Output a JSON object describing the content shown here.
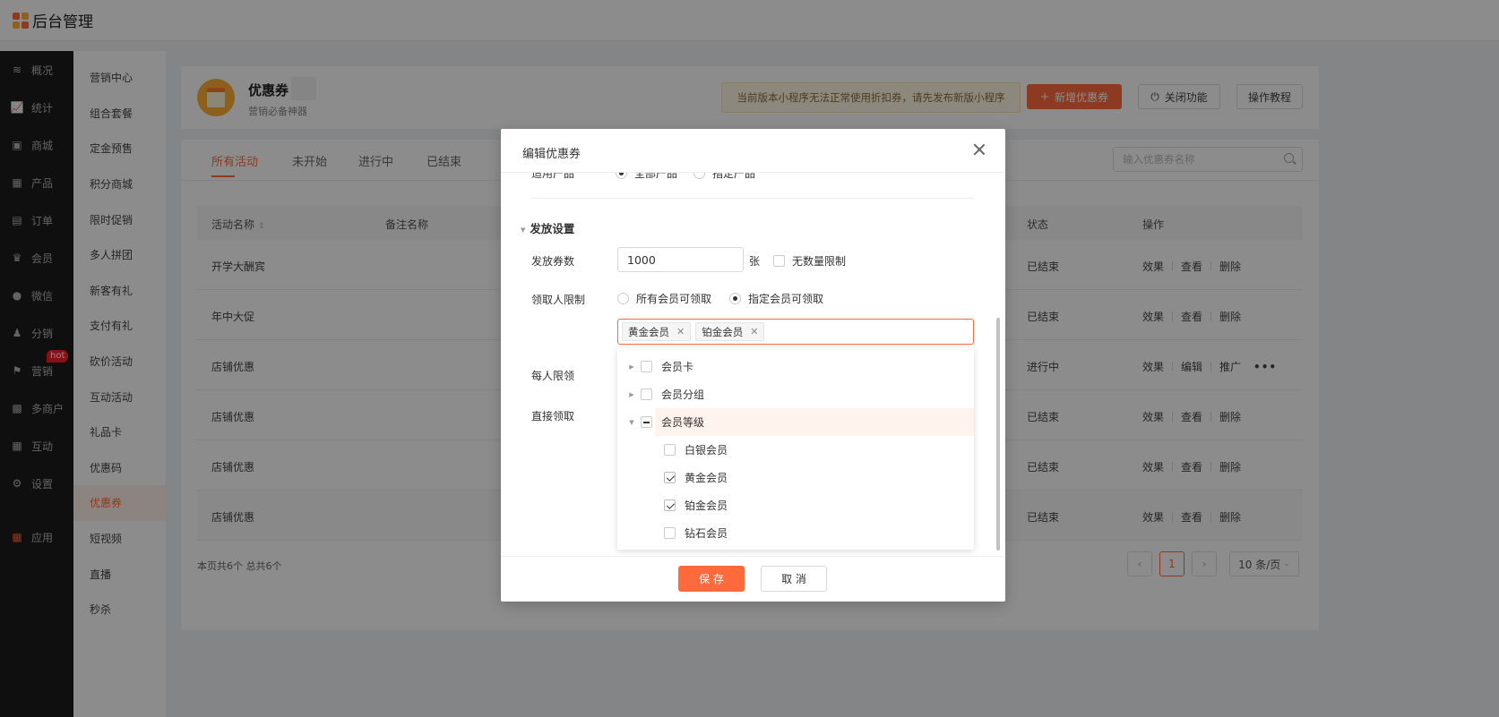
{
  "app": {
    "title": "后台管理"
  },
  "main_nav": [
    {
      "label": "概况",
      "icon": "overview-icon"
    },
    {
      "label": "统计",
      "icon": "chart-icon"
    },
    {
      "label": "商城",
      "icon": "shop-icon"
    },
    {
      "label": "产品",
      "icon": "grid-icon"
    },
    {
      "label": "订单",
      "icon": "order-icon"
    },
    {
      "label": "会员",
      "icon": "crown-icon"
    },
    {
      "label": "微信",
      "icon": "wechat-icon"
    },
    {
      "label": "分销",
      "icon": "users-icon"
    },
    {
      "label": "营销",
      "icon": "flag-icon",
      "badge": "hot",
      "active": true
    },
    {
      "label": "多商户",
      "icon": "store-icon"
    },
    {
      "label": "互动",
      "icon": "grid-icon"
    },
    {
      "label": "设置",
      "icon": "gear-icon"
    },
    {
      "label": "应用",
      "icon": "apps-icon"
    }
  ],
  "sub_nav": [
    "营销中心",
    "组合套餐",
    "定金预售",
    "积分商城",
    "限时促销",
    "多人拼团",
    "新客有礼",
    "支付有礼",
    "砍价活动",
    "互动活动",
    "礼品卡",
    "优惠码",
    "优惠券",
    "短视频",
    "直播",
    "秒杀"
  ],
  "sub_nav_active": "优惠券",
  "header": {
    "title": "优惠券",
    "subtitle": "营销必备神器",
    "notice": "当前版本小程序无法正常使用折扣券，请先发布新版小程序",
    "add_button": "新增优惠券",
    "close_button": "关闭功能",
    "tutorial_button": "操作教程"
  },
  "tabs": [
    "所有活动",
    "未开始",
    "进行中",
    "已结束"
  ],
  "search": {
    "placeholder": "输入优惠券名称"
  },
  "table": {
    "columns": {
      "name": "活动名称",
      "remark": "备注名称",
      "status": "状态",
      "ops": "操作"
    },
    "rows": [
      {
        "name": "开学大酬宾",
        "status": "已结束",
        "ops": [
          "效果",
          "查看",
          "删除"
        ]
      },
      {
        "name": "年中大促",
        "status": "已结束",
        "ops": [
          "效果",
          "查看",
          "删除"
        ]
      },
      {
        "name": "店铺优惠",
        "status": "进行中",
        "ops": [
          "效果",
          "编辑",
          "推广"
        ],
        "more": "•••"
      },
      {
        "name": "店铺优惠",
        "status": "已结束",
        "ops": [
          "效果",
          "查看",
          "删除"
        ]
      },
      {
        "name": "店铺优惠",
        "status": "已结束",
        "ops": [
          "效果",
          "查看",
          "删除"
        ]
      },
      {
        "name": "店铺优惠",
        "status": "已结束",
        "ops": [
          "效果",
          "查看",
          "删除"
        ]
      }
    ]
  },
  "pagination": {
    "info": "本页共6个 总共6个",
    "current": "1",
    "page_size": "10 条/页"
  },
  "modal": {
    "title": "编辑优惠券",
    "cut_label": "适用产品",
    "cut_opt1": "全部产品",
    "cut_opt2": "指定产品",
    "section": "发放设置",
    "count_label": "发放券数",
    "count_value": "1000",
    "count_unit": "张",
    "unlimited_label": "无数量限制",
    "limit_label": "领取人限制",
    "limit_opt_all": "所有会员可领取",
    "limit_opt_specific": "指定会员可领取",
    "selected_tags": [
      "黄金会员",
      "铂金会员"
    ],
    "per_person_label": "每人限领",
    "direct_label": "直接领取",
    "tree": [
      {
        "label": "会员卡",
        "checked": false
      },
      {
        "label": "会员分组",
        "checked": false
      },
      {
        "label": "会员等级",
        "checked": "partial"
      },
      {
        "label": "白银会员",
        "checked": false
      },
      {
        "label": "黄金会员",
        "checked": true
      },
      {
        "label": "铂金会员",
        "checked": true
      },
      {
        "label": "钻石会员",
        "checked": false
      }
    ],
    "save": "保 存",
    "cancel": "取 消"
  },
  "colors": {
    "accent": "#ff6a3d",
    "sidebar": "#1c1c1c"
  }
}
